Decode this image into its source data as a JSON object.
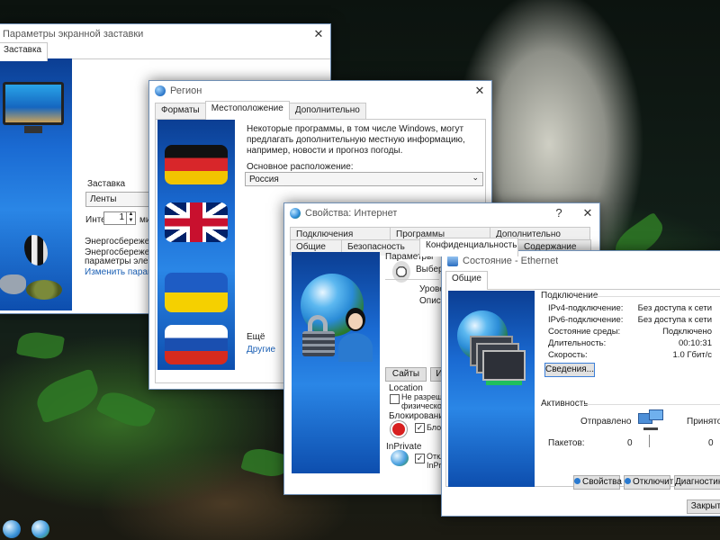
{
  "desktop": {
    "taskbar_icons": [
      "network-icon",
      "ie-globe-icon"
    ]
  },
  "screensaver": {
    "title": "Параметры экранной заставки",
    "tab": "Заставка",
    "group_label": "Заставка",
    "select_value": "Ленты",
    "interval_label": "Интер",
    "interval_value": "1",
    "minutes_short": "ми",
    "power_group": "Энергосбережение",
    "power_text_1": "Энергосбережение",
    "power_text_2": "параметры электр",
    "power_link": "Изменить параметр"
  },
  "region": {
    "title": "Регион",
    "tabs": [
      "Форматы",
      "Местоположение",
      "Дополнительно"
    ],
    "description": "Некоторые программы, в том числе Windows, могут предлагать дополнительную местную информацию, например, новости и прогноз погоды.",
    "location_label": "Основное расположение:",
    "location_value": "Россия",
    "more_label": "Ещё",
    "others_link": "Другие"
  },
  "internet": {
    "title": "Свойства: Интернет",
    "help": "?",
    "tabs_row1": [
      "Подключения",
      "Программы",
      "Дополнительно"
    ],
    "tabs_row2": [
      "Общие",
      "Безопасность",
      "Конфиденциальность",
      "Содержание"
    ],
    "params_label": "Параметры",
    "choose_text": "Выберит",
    "level_text": "Уровень",
    "desc_text": "Описани",
    "sites_button": "Сайты",
    "import_button": "И",
    "location_group": "Location",
    "location_cb_1": "Не разрешать",
    "location_cb_2": "физическое ме",
    "popup_group": "Блокирование всп",
    "popup_cb": "Блоки",
    "inprivate_group": "InPrivate",
    "inprivate_cb_1": "Откл",
    "inprivate_cb_2": "InPriva"
  },
  "ethernet": {
    "title": "Состояние - Ethernet",
    "tab": "Общие",
    "connection_group": "Подключение",
    "rows": [
      {
        "label": "IPv4-подключение:",
        "value": "Без доступа к сети"
      },
      {
        "label": "IPv6-подключение:",
        "value": "Без доступа к сети"
      },
      {
        "label": "Состояние среды:",
        "value": "Подключено"
      },
      {
        "label": "Длительность:",
        "value": "00:10:31"
      },
      {
        "label": "Скорость:",
        "value": "1.0 Гбит/с"
      }
    ],
    "details_button": "Сведения...",
    "activity_group": "Активность",
    "sent_label": "Отправлено",
    "received_label": "Принято",
    "packets_label": "Пакетов:",
    "packets_sent": "0",
    "packets_received": "0",
    "properties_button": "Свойства",
    "disable_button": "Отключить",
    "diagnose_button": "Диагностика",
    "close_button": "Закрыть"
  }
}
